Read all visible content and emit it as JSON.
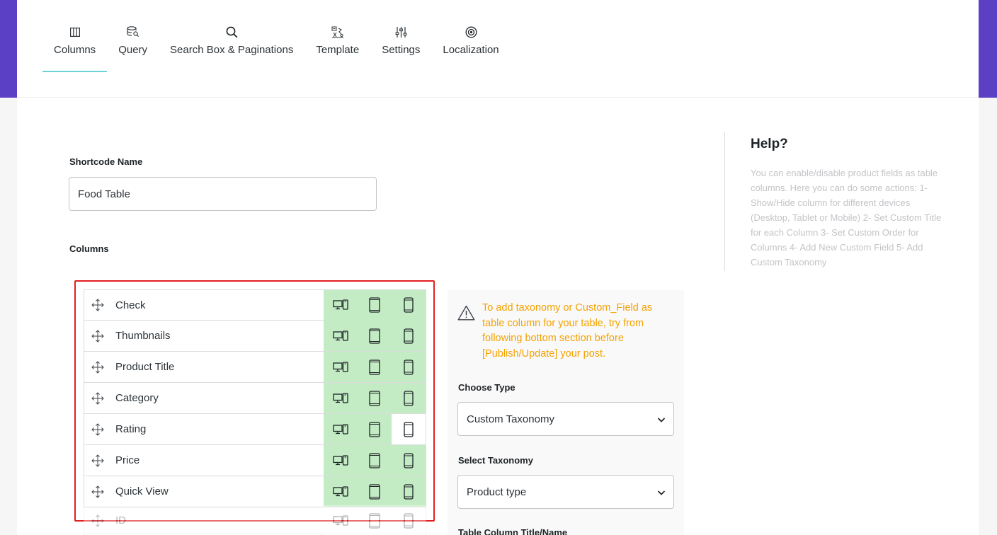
{
  "tabs": [
    {
      "label": "Columns",
      "icon": "columns-icon",
      "active": true
    },
    {
      "label": "Query",
      "icon": "database-search-icon",
      "active": false
    },
    {
      "label": "Search Box & Paginations",
      "icon": "search-icon",
      "active": false
    },
    {
      "label": "Template",
      "icon": "template-icon",
      "active": false
    },
    {
      "label": "Settings",
      "icon": "sliders-icon",
      "active": false
    },
    {
      "label": "Localization",
      "icon": "target-icon",
      "active": false
    }
  ],
  "shortcode": {
    "label": "Shortcode Name",
    "value": "Food Table"
  },
  "columns_section": {
    "label": "Columns",
    "rows": [
      {
        "name": "Check",
        "desktop": true,
        "tablet": true,
        "mobile": true
      },
      {
        "name": "Thumbnails",
        "desktop": true,
        "tablet": true,
        "mobile": true
      },
      {
        "name": "Product Title",
        "desktop": true,
        "tablet": true,
        "mobile": true
      },
      {
        "name": "Category",
        "desktop": true,
        "tablet": true,
        "mobile": true
      },
      {
        "name": "Rating",
        "desktop": true,
        "tablet": true,
        "mobile": false
      },
      {
        "name": "Price",
        "desktop": true,
        "tablet": true,
        "mobile": true
      },
      {
        "name": "Quick View",
        "desktop": true,
        "tablet": true,
        "mobile": true
      },
      {
        "name": "ID",
        "desktop": false,
        "tablet": false,
        "mobile": false
      }
    ]
  },
  "taxonomy_panel": {
    "warning": "To add taxonomy or Custom_Field as table column for your table, try from following bottom section before [Publish/Update] your post.",
    "choose_type_label": "Choose Type",
    "choose_type_value": "Custom Taxonomy",
    "select_taxonomy_label": "Select Taxonomy",
    "select_taxonomy_value": "Product type",
    "column_title_label": "Table Column Title/Name"
  },
  "help": {
    "title": "Help?",
    "text": "You can enable/disable product fields as table columns. Here you can do some actions: 1- Show/Hide column for different devices (Desktop, Tablet or Mobile) 2- Set Custom Title for each Column 3- Set Custom Order for Columns 4- Add New Custom Field 5- Add Custom Taxonomy"
  },
  "colors": {
    "brand": "#5b3fc4",
    "active_tab_underline": "#6ad3d8",
    "device_enabled_bg": "#c4ecc4",
    "warning_text": "#f5a200",
    "highlight_frame": "#e02020"
  }
}
